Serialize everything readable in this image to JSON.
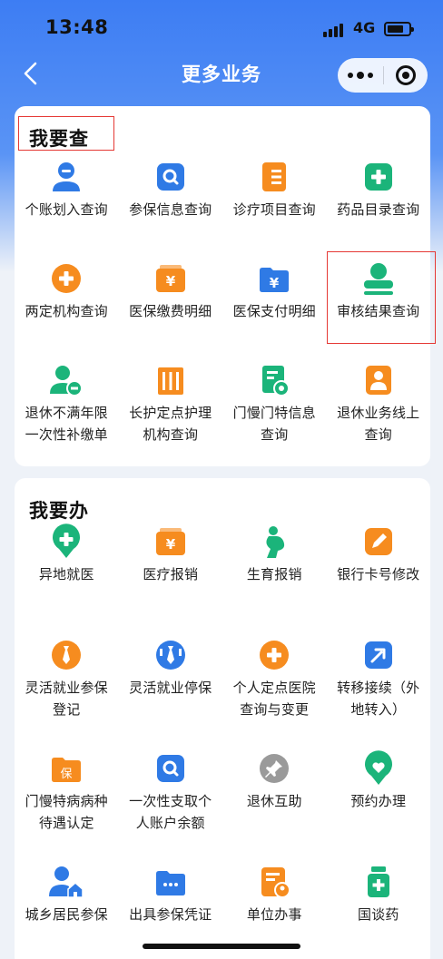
{
  "status_bar": {
    "time": "13:48",
    "network": "4G",
    "battery_level": 0.75
  },
  "nav": {
    "title": "更多业务",
    "back_icon": "chevron-left-icon",
    "more_icon": "more-dots-icon",
    "close_icon": "target-close-icon"
  },
  "colors": {
    "orange": "#f68c1f",
    "blue": "#2f7ae5",
    "green": "#1bb47a",
    "gray": "#9a9a9a",
    "annotation": "#e53935"
  },
  "query_section": {
    "title": "我要查",
    "items": [
      {
        "label": "个账划入查询",
        "icon": "person-icon",
        "color": "#2f7ae5"
      },
      {
        "label": "参保信息查询",
        "icon": "search-doc-icon",
        "color": "#2f7ae5"
      },
      {
        "label": "诊疗项目查询",
        "icon": "list-doc-icon",
        "color": "#f68c1f"
      },
      {
        "label": "药品目录查询",
        "icon": "medical-cross-icon",
        "color": "#1bb47a"
      },
      {
        "label": "两定机构查询",
        "icon": "hospital-cross-icon",
        "color": "#f68c1f"
      },
      {
        "label": "医保缴费明细",
        "icon": "yen-wallet-icon",
        "color": "#f68c1f"
      },
      {
        "label": "医保支付明细",
        "icon": "yen-folder-icon",
        "color": "#2f7ae5"
      },
      {
        "label": "审核结果查询",
        "icon": "stamp-icon",
        "color": "#1bb47a"
      },
      {
        "label": "退休不满年限\n一次性补缴单",
        "icon": "person-minus-icon",
        "color": "#1bb47a"
      },
      {
        "label": "长护定点护理\n机构查询",
        "icon": "building-icon",
        "color": "#f68c1f"
      },
      {
        "label": "门慢门特信息\n查询",
        "icon": "doc-gear-icon",
        "color": "#1bb47a"
      },
      {
        "label": "退休业务线上\n查询",
        "icon": "person-card-icon",
        "color": "#f68c1f"
      }
    ]
  },
  "do_section": {
    "title": "我要办",
    "items": [
      {
        "label": "异地就医",
        "icon": "location-cross-icon",
        "color": "#1bb47a"
      },
      {
        "label": "医疗报销",
        "icon": "yen-wallet-icon",
        "color": "#f68c1f"
      },
      {
        "label": "生育报销",
        "icon": "pregnancy-icon",
        "color": "#1bb47a"
      },
      {
        "label": "银行卡号修改",
        "icon": "edit-pen-icon",
        "color": "#f68c1f"
      },
      {
        "label": "灵活就业参保\n登记",
        "icon": "tie-icon",
        "color": "#f68c1f"
      },
      {
        "label": "灵活就业停保",
        "icon": "tie-pause-icon",
        "color": "#2f7ae5"
      },
      {
        "label": "个人定点医院\n查询与变更",
        "icon": "hospital-cross-icon",
        "color": "#f68c1f"
      },
      {
        "label": "转移接续（外\n地转入）",
        "icon": "transfer-arrow-icon",
        "color": "#2f7ae5"
      },
      {
        "label": "门慢特病病种\n待遇认定",
        "icon": "bao-folder-icon",
        "color": "#f68c1f"
      },
      {
        "label": "一次性支取个\n人账户余额",
        "icon": "search-doc-icon",
        "color": "#2f7ae5"
      },
      {
        "label": "退休互助",
        "icon": "pin-icon",
        "color": "#9a9a9a"
      },
      {
        "label": "预约办理",
        "icon": "heart-pin-icon",
        "color": "#1bb47a"
      },
      {
        "label": "城乡居民参保",
        "icon": "person-house-icon",
        "color": "#2f7ae5"
      },
      {
        "label": "出具参保凭证",
        "icon": "dots-folder-icon",
        "color": "#2f7ae5"
      },
      {
        "label": "单位办事",
        "icon": "doc-person-icon",
        "color": "#f68c1f"
      },
      {
        "label": "国谈药",
        "icon": "medicine-bottle-icon",
        "color": "#1bb47a"
      }
    ]
  }
}
